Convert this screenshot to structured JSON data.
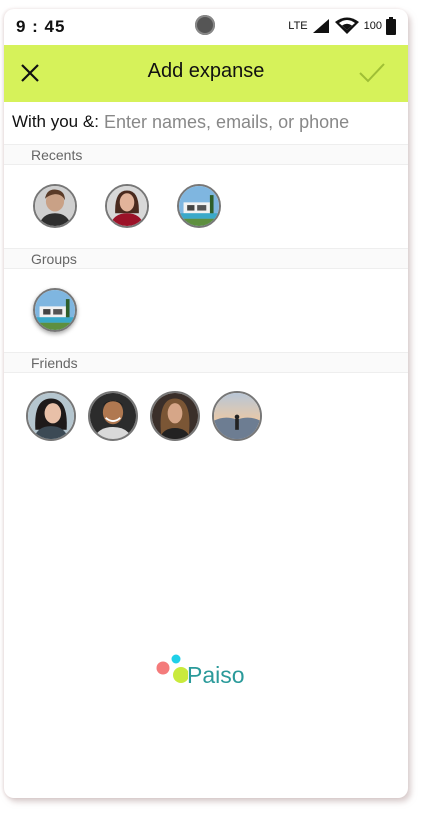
{
  "status_bar": {
    "time": "9 : 45",
    "network": "LTE",
    "battery": "100"
  },
  "app_bar": {
    "title": "Add expanse"
  },
  "with_row": {
    "label": "With you &:",
    "placeholder": "Enter names, emails, or phone"
  },
  "sections": {
    "recents": "Recents",
    "groups": "Groups",
    "friends": "Friends"
  },
  "brand": {
    "name": "Paiso"
  },
  "colors": {
    "accent": "#d6f25a",
    "brand_text": "#2a9a9a",
    "dot_coral": "#f47b7b",
    "dot_cyan": "#1fd0e8",
    "dot_lime": "#c9ea3c"
  }
}
